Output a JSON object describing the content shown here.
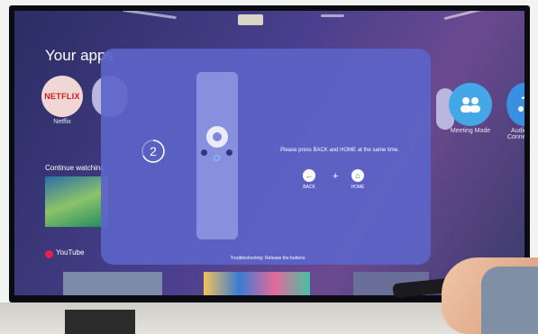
{
  "home": {
    "section_title": "Your apps",
    "apps": [
      {
        "name": "Netflix",
        "logo_text": "NETFLIX"
      },
      {
        "name": "Meeting Mode"
      },
      {
        "name": "Audio Connect"
      }
    ],
    "continue_label": "Continue watching",
    "youtube_label": "YouTube"
  },
  "dialog": {
    "countdown": "2",
    "instruction": "Please press BACK and HOME at the same time.",
    "back_label": "BACK",
    "home_label": "HOME",
    "plus": "+",
    "footer": "Troubleshooting: Release the buttons"
  },
  "colors": {
    "dialog_bg": "#5c64c8",
    "netflix_red": "#d21c1c",
    "meeting_blue": "#44a8e8",
    "youtube_red": "#e2234b"
  },
  "icons": [
    "back-arrow-icon",
    "home-icon",
    "meeting-icon",
    "audio-icon",
    "dpad-icon"
  ]
}
